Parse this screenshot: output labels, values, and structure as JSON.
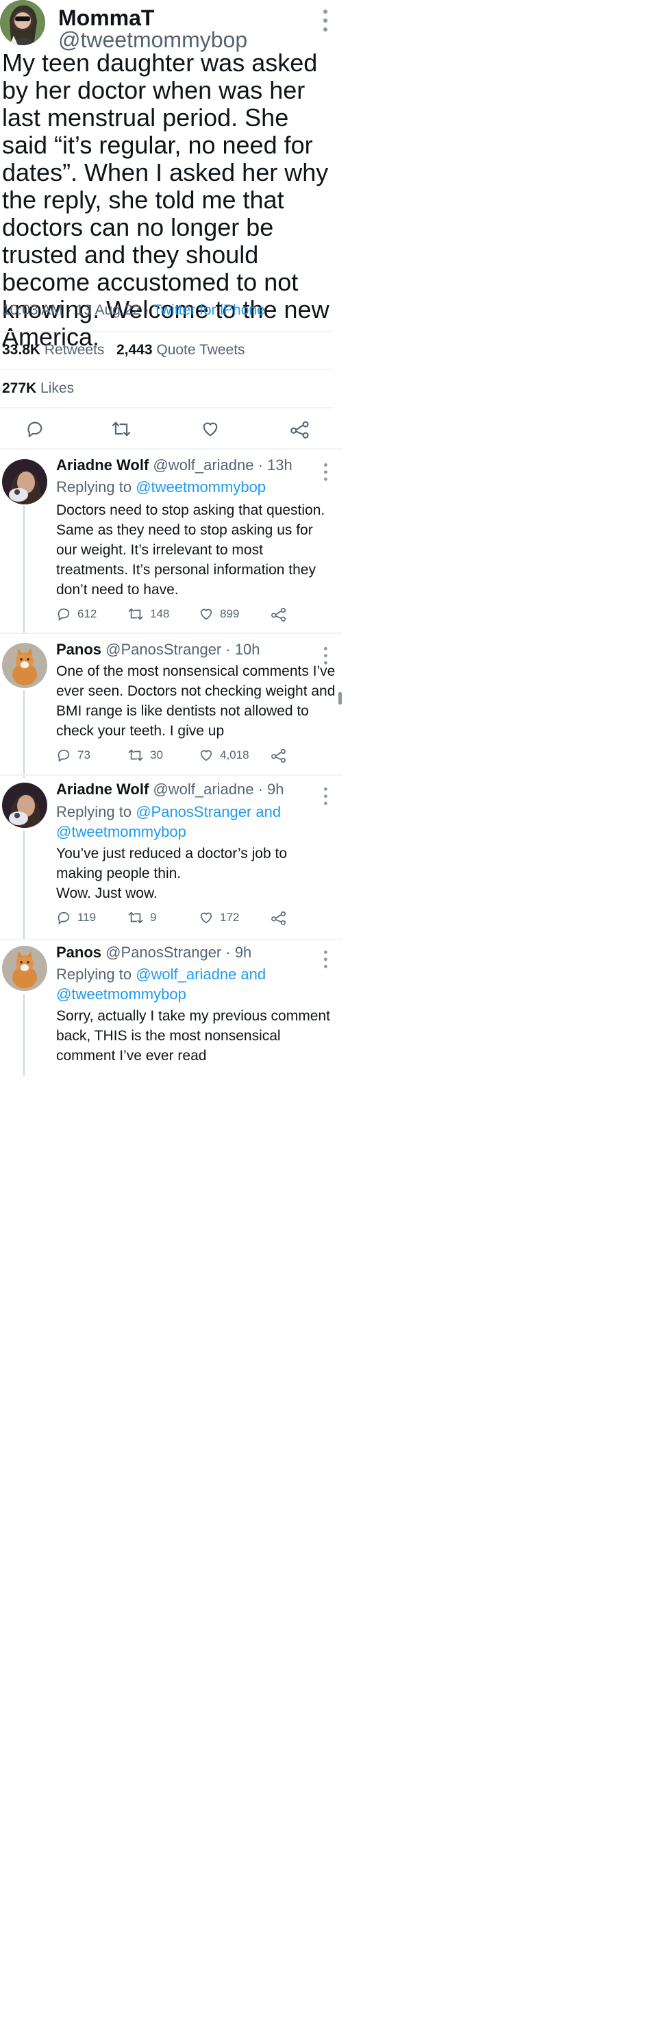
{
  "main_tweet": {
    "name": "MommaT",
    "handle": "@tweetmommybop",
    "text": "My teen daughter was asked by her doctor when was her last menstrual period. She said “it’s regular, no need for dates”. When I asked her why the reply, she told me that doctors can no longer be trusted and they should become accustomed to not knowing. Welcome to the new America.",
    "time": "10:03 AM",
    "sep1": "·",
    "date": "13 Aug 22",
    "sep2": "·",
    "source": "Twitter for iPhone",
    "retweets_count": "33.8K",
    "retweets_label": "Retweets",
    "quotes_count": "2,443",
    "quotes_label": "Quote Tweets",
    "likes_count": "277K",
    "likes_label": "Likes"
  },
  "replies": [
    {
      "name": "Ariadne Wolf",
      "handle": "@wolf_ariadne",
      "time": "· 13h",
      "replying_prefix": "Replying to",
      "replying_to": "@tweetmommybop",
      "replying_to_2": "",
      "text": "Doctors need to stop asking that question. Same as they need to stop asking us for our weight. It’s irrelevant to most treatments. It’s personal information they don’t need to have.",
      "replies": "612",
      "retweets": "148",
      "likes": "899"
    },
    {
      "name": "Panos",
      "handle": "@PanosStranger",
      "time": "· 10h",
      "text": "One of the most nonsensical comments I’ve ever seen. Doctors not checking weight and BMI range is like dentists not allowed to check your teeth. I give up",
      "replies": "73",
      "retweets": "30",
      "likes": "4,018"
    },
    {
      "name": "Ariadne Wolf",
      "handle": "@wolf_ariadne",
      "time": "· 9h",
      "replying_prefix": "Replying to",
      "replying_to": "@PanosStranger and",
      "replying_to_2": "@tweetmommybop",
      "text": "You’ve just reduced a doctor’s job to making people thin.\nWow. Just wow.",
      "replies": "119",
      "retweets": "9",
      "likes": "172"
    },
    {
      "name": "Panos",
      "handle": "@PanosStranger",
      "time": "· 9h",
      "replying_prefix": "Replying to",
      "replying_to": "@wolf_ariadne and",
      "replying_to_2": "@tweetmommybop",
      "text": "Sorry, actually I take my previous comment back, THIS is the most nonsensical comment I’ve ever read"
    }
  ],
  "icons": {
    "reply": "reply-icon",
    "retweet": "retweet-icon",
    "like": "heart-icon",
    "share": "share-icon",
    "more": "more-icon"
  },
  "colors": {
    "accent": "#1d9bf0",
    "text": "#0f1419",
    "muted": "#536471",
    "divider": "#eff3f4"
  }
}
